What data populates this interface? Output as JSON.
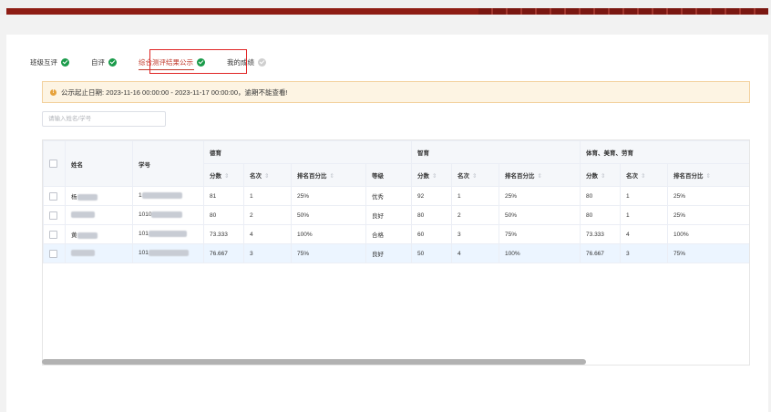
{
  "tabs": [
    {
      "label": "班级互评",
      "status": "done"
    },
    {
      "label": "自评",
      "status": "done"
    },
    {
      "label": "综合测评结果公示",
      "status": "done"
    },
    {
      "label": "我的成绩",
      "status": "pending"
    }
  ],
  "alert": {
    "text": "公示起止日期: 2023-11-16 00:00:00 - 2023-11-17 00:00:00，逾期不能查看!"
  },
  "search": {
    "placeholder": "请输入姓名/学号"
  },
  "table": {
    "col_name": "姓名",
    "col_id": "学号",
    "groups": [
      "德育",
      "智育",
      "体育、美育、劳育"
    ],
    "sub": {
      "score": "分数",
      "rank": "名次",
      "percent": "排名百分比",
      "grade": "等级"
    },
    "rows": [
      {
        "name": "杨",
        "id": "1",
        "d_score": "81",
        "d_rank": "1",
        "d_pct": "25%",
        "d_grade": "优秀",
        "z_score": "92",
        "z_rank": "1",
        "z_pct": "25%",
        "t_score": "80",
        "t_rank": "1",
        "t_pct": "25%"
      },
      {
        "name": "",
        "id": "1010",
        "d_score": "80",
        "d_rank": "2",
        "d_pct": "50%",
        "d_grade": "良好",
        "z_score": "80",
        "z_rank": "2",
        "z_pct": "50%",
        "t_score": "80",
        "t_rank": "1",
        "t_pct": "25%"
      },
      {
        "name": "黄",
        "id": "101",
        "d_score": "73.333",
        "d_rank": "4",
        "d_pct": "100%",
        "d_grade": "合格",
        "z_score": "60",
        "z_rank": "3",
        "z_pct": "75%",
        "t_score": "73.333",
        "t_rank": "4",
        "t_pct": "100%"
      },
      {
        "name": "",
        "id": "101",
        "d_score": "76.667",
        "d_rank": "3",
        "d_pct": "75%",
        "d_grade": "良好",
        "z_score": "50",
        "z_rank": "4",
        "z_pct": "100%",
        "t_score": "76.667",
        "t_rank": "3",
        "t_pct": "75%"
      }
    ]
  },
  "colors": {
    "brand": "#8e1d14",
    "success": "#1a9b4a",
    "warning": "#e6a23c",
    "active_tab": "#c0392b"
  }
}
